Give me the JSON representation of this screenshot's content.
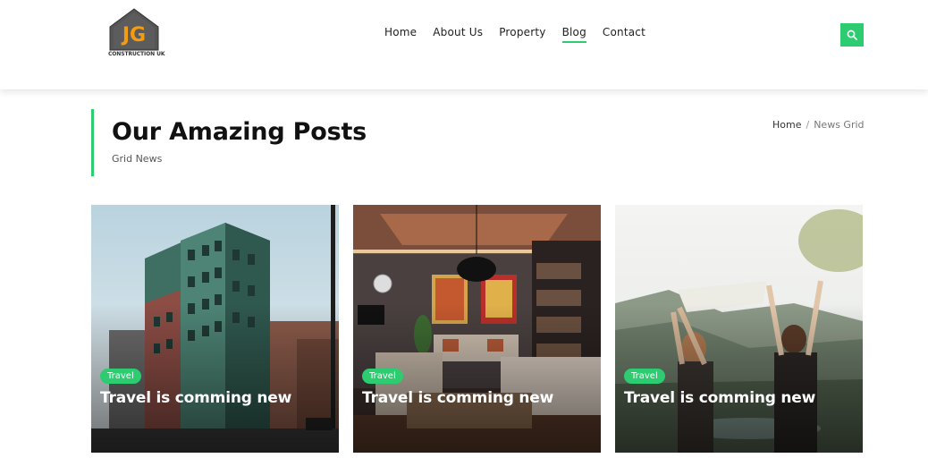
{
  "header": {
    "logo_text": "JG",
    "logo_caption": "CONSTRUCTION UK",
    "nav": [
      {
        "label": "Home",
        "active": false
      },
      {
        "label": "About Us",
        "active": false
      },
      {
        "label": "Property",
        "active": false
      },
      {
        "label": "Blog",
        "active": true
      },
      {
        "label": "Contact",
        "active": false
      }
    ],
    "search_icon": "search-icon"
  },
  "page": {
    "title": "Our Amazing Posts",
    "subtitle": "Grid News",
    "breadcrumb": [
      "Home",
      "News Grid"
    ],
    "breadcrumb_separator": "/"
  },
  "posts": [
    {
      "tag": "Travel",
      "title": "Travel is comming new",
      "image": "city-building"
    },
    {
      "tag": "Travel",
      "title": "Travel is comming new",
      "image": "living-room"
    },
    {
      "tag": "Travel",
      "title": "Travel is comming new",
      "image": "cliff-travelers"
    }
  ],
  "colors": {
    "accent": "#2ecc71",
    "logo_orange": "#f39c12",
    "logo_dark": "#555555"
  }
}
